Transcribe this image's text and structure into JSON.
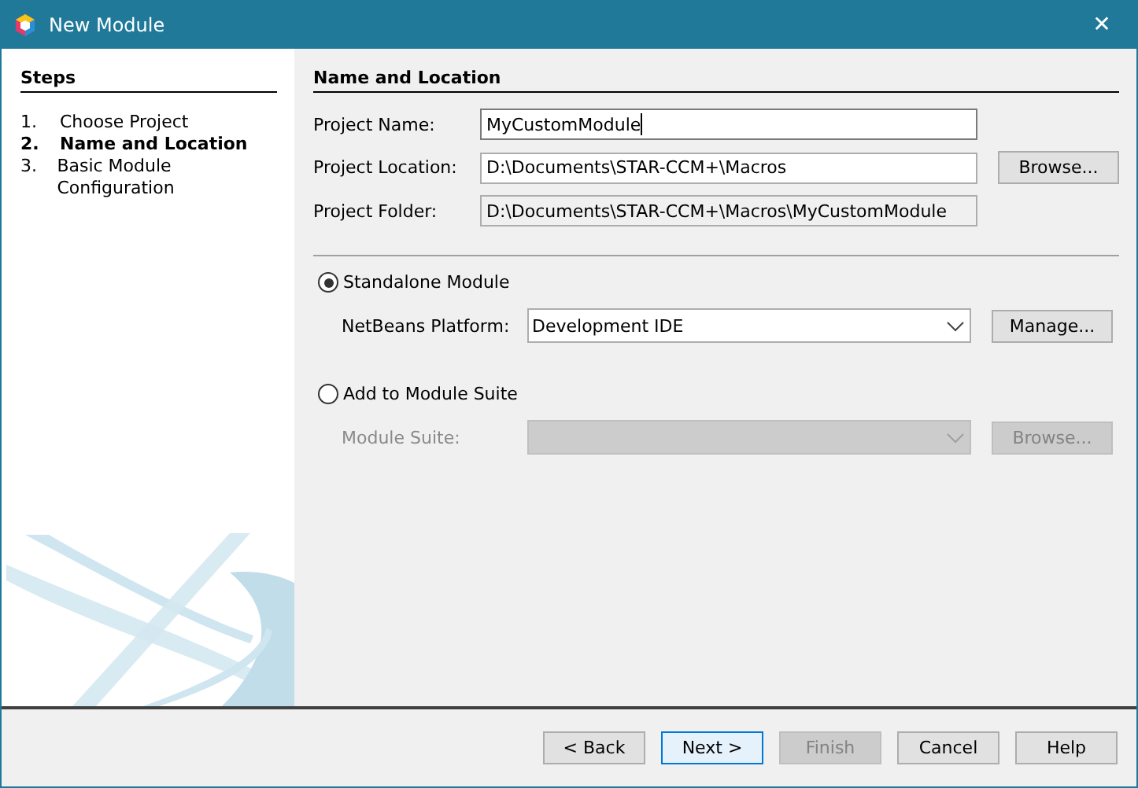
{
  "window": {
    "title": "New Module",
    "close": "✕"
  },
  "steps": {
    "title": "Steps",
    "items": [
      {
        "number": "1.",
        "label": "Choose Project",
        "selected": false
      },
      {
        "number": "2.",
        "label": "Name and Location",
        "selected": true
      },
      {
        "number": "3.",
        "label": "Basic Module Configuration",
        "selected": false
      }
    ]
  },
  "panel": {
    "title": "Name and Location",
    "fields": [
      {
        "label": "Project Name:",
        "value": "MyCustomModule",
        "readonly": false,
        "focused": true
      },
      {
        "label": "Project Location:",
        "value": "D:\\Documents\\STAR-CCM+\\Macros",
        "readonly": false,
        "focused": false,
        "button": "Browse..."
      },
      {
        "label": "Project Folder:",
        "value": "D:\\Documents\\STAR-CCM+\\Macros\\MyCustomModule",
        "readonly": true,
        "focused": false
      }
    ],
    "options": [
      {
        "label": "Standalone Module",
        "selected": true,
        "combo": {
          "label": "NetBeans Platform:",
          "value": "Development IDE",
          "disabled": false,
          "button": "Manage..."
        }
      },
      {
        "label": "Add to Module Suite",
        "selected": false,
        "combo": {
          "label": "Module Suite:",
          "disabled": true,
          "button": "Browse..."
        }
      }
    ]
  },
  "footer": {
    "buttons": [
      {
        "label": "< Back",
        "disabled": false,
        "default": false
      },
      {
        "label": "Next >",
        "disabled": false,
        "default": true
      },
      {
        "label": "Finish",
        "disabled": true,
        "default": false
      },
      {
        "label": "Cancel",
        "disabled": false,
        "default": false
      },
      {
        "label": "Help",
        "disabled": false,
        "default": false
      }
    ]
  }
}
